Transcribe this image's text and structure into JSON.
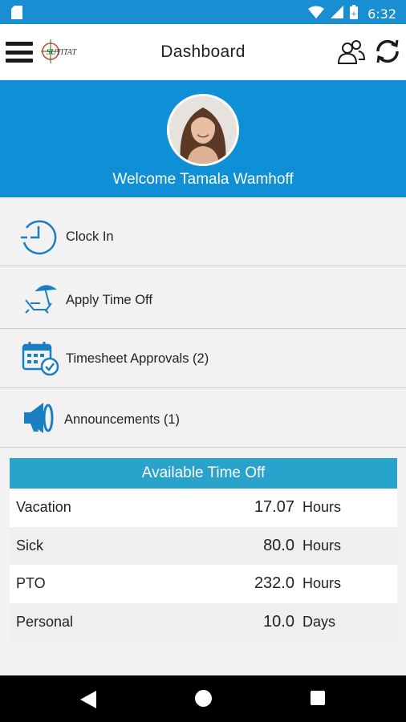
{
  "status_bar": {
    "time": "6:32",
    "icons": [
      "sd-card-icon",
      "wifi-icon",
      "signal-icon",
      "battery-icon"
    ]
  },
  "app_bar": {
    "logo_text": "SUTITAT",
    "title": "Dashboard",
    "icons": [
      "menu-icon",
      "people-icon",
      "refresh-icon"
    ]
  },
  "profile": {
    "welcome": "Welcome Tamala Wamhoff"
  },
  "menu": {
    "items": [
      {
        "label": "Clock In",
        "icon": "clock-icon"
      },
      {
        "label": "Apply Time Off",
        "icon": "beach-chair-icon"
      },
      {
        "label": "Timesheet Approvals (2)",
        "icon": "calendar-check-icon"
      },
      {
        "label": "Announcements (1)",
        "icon": "megaphone-icon"
      }
    ]
  },
  "time_off": {
    "header": "Available Time Off",
    "rows": [
      {
        "name": "Vacation",
        "value": "17.07",
        "unit": "Hours"
      },
      {
        "name": "Sick",
        "value": "80.0",
        "unit": "Hours"
      },
      {
        "name": "PTO",
        "value": "232.0",
        "unit": "Hours"
      },
      {
        "name": "Personal",
        "value": "10.0",
        "unit": "Days"
      }
    ]
  },
  "colors": {
    "primary": "#0e8fd6",
    "status_bar": "#1a8ed3",
    "table_header": "#2aa3cc",
    "icon_blue": "#1a7fc1"
  }
}
